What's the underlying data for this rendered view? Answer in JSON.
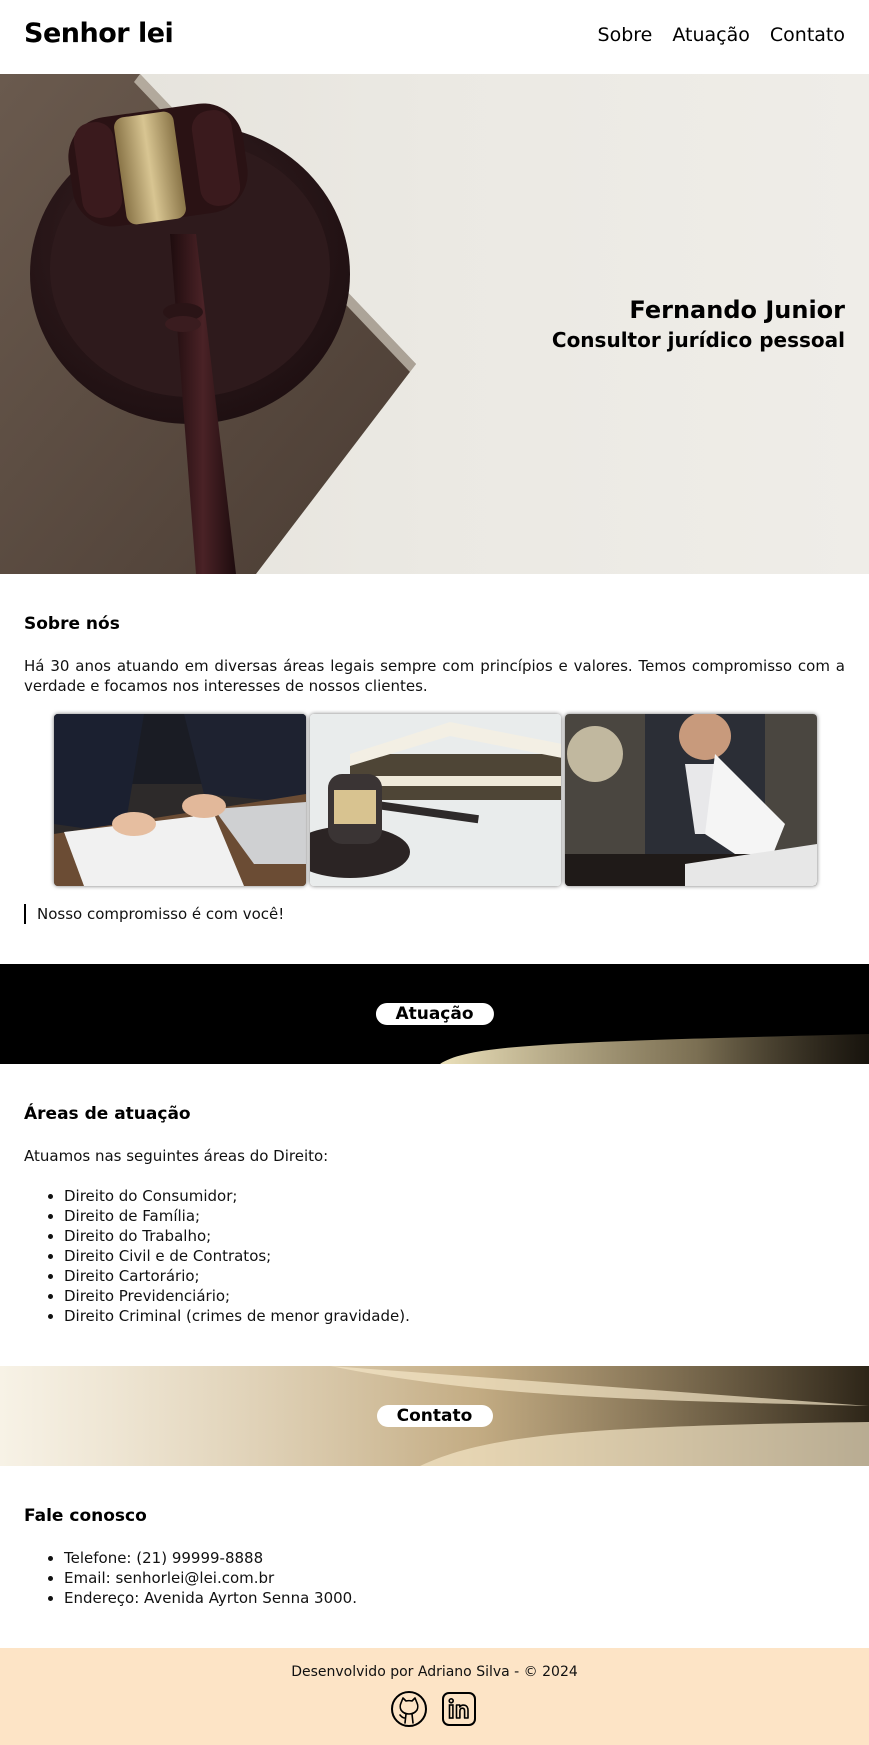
{
  "header": {
    "brand": "Senhor lei",
    "nav": [
      "Sobre",
      "Atuação",
      "Contato"
    ]
  },
  "hero": {
    "name": "Fernando Junior",
    "subtitle": "Consultor jurídico pessoal",
    "image": "gavel-on-book-photo"
  },
  "about": {
    "title": "Sobre nós",
    "text": "Há 30 anos atuando em diversas áreas legais sempre com princípios e valores. Temos compromisso com a verdade e focamos nos interesses de nossos clientes.",
    "photos": [
      "signing-contract-photo",
      "gavel-and-books-photo",
      "lawyer-reading-document-photo"
    ],
    "quote": "Nosso compromisso é com você!"
  },
  "band1": {
    "label": "Atuação"
  },
  "areas": {
    "title": "Áreas de atuação",
    "intro": "Atuamos nas seguintes áreas do Direito:",
    "items": [
      "Direito do Consumidor;",
      "Direito de Família;",
      "Direito do Trabalho;",
      "Direito Civil e de Contratos;",
      "Direito Cartorário;",
      "Direito Previdenciário;",
      "Direito Criminal (crimes de menor gravidade)."
    ]
  },
  "band2": {
    "label": "Contato"
  },
  "contact": {
    "title": "Fale conosco",
    "items": [
      "Telefone: (21) 99999-8888",
      "Email: senhorlei@lei.com.br",
      "Endereço: Avenida Ayrton Senna 3000."
    ]
  },
  "footer": {
    "text": "Desenvolvido por Adriano Silva - © 2024",
    "icons": [
      "github-icon",
      "linkedin-icon"
    ]
  }
}
